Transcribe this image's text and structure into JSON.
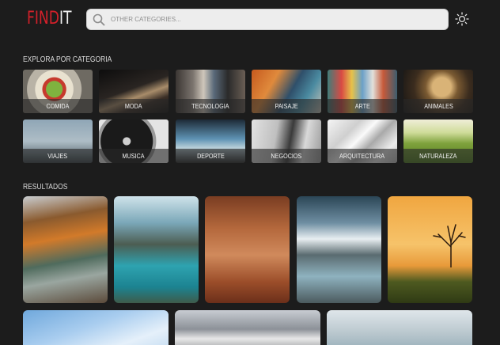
{
  "logo": {
    "part1": "FIND",
    "part2": "IT"
  },
  "search": {
    "placeholder": "OTHER CATEGORIES...",
    "icon": "search-icon"
  },
  "theme_toggle": {
    "icon": "sun-icon"
  },
  "categories_heading": "EXPLORA POR CATEGORIA",
  "categories": [
    {
      "label": "COMIDA"
    },
    {
      "label": "MODA"
    },
    {
      "label": "TECNOLOGIA"
    },
    {
      "label": "PAISAJE"
    },
    {
      "label": "ARTE"
    },
    {
      "label": "ANIMALES"
    },
    {
      "label": "VIAJES"
    },
    {
      "label": "MUSICA"
    },
    {
      "label": "DEPORTE"
    },
    {
      "label": "NEGOCIOS"
    },
    {
      "label": "ARQUITECTURA"
    },
    {
      "label": "NATURALEZA"
    }
  ],
  "results_heading": "RESULTADOS",
  "colors": {
    "background": "#1c1c1c",
    "logo_accent": "#d3202a",
    "search_bg": "#ededed"
  }
}
